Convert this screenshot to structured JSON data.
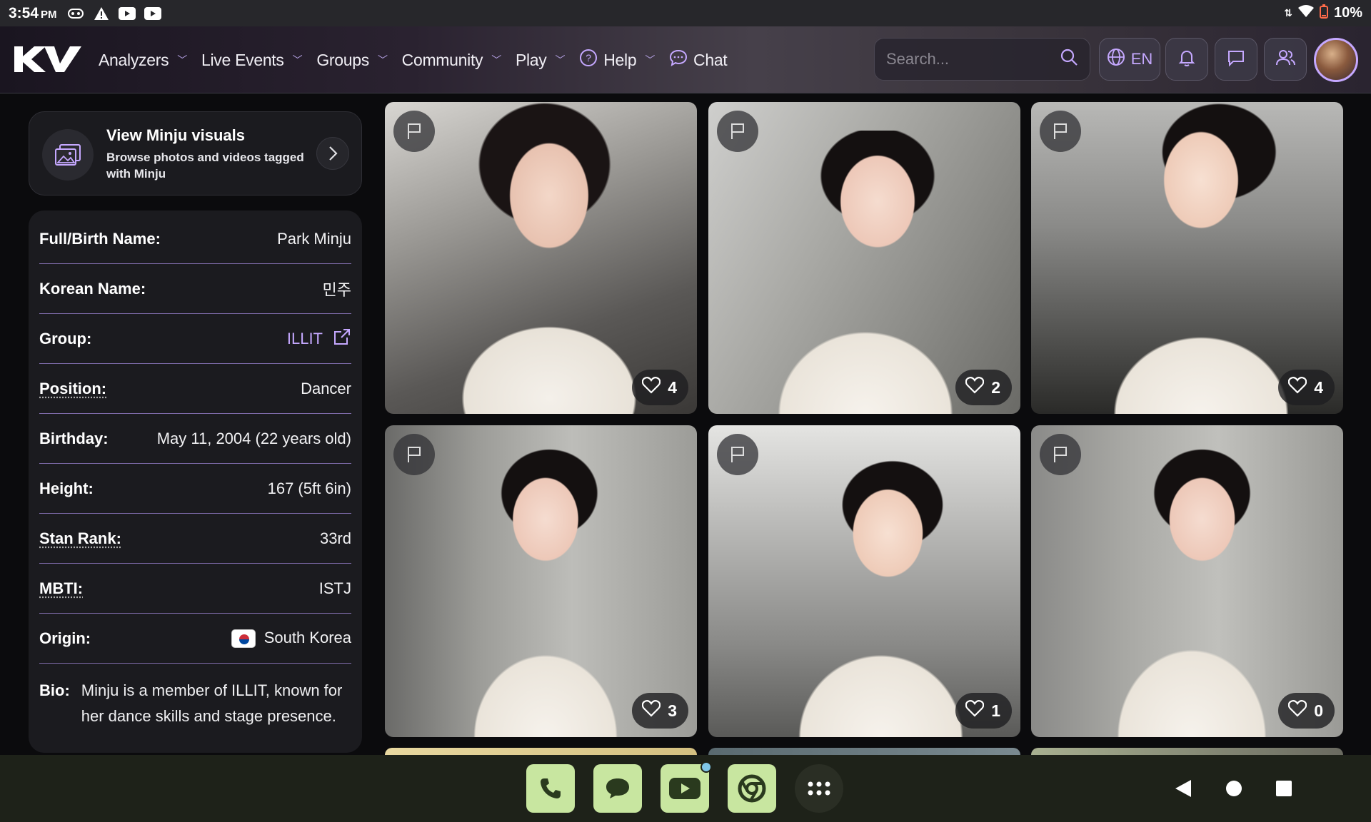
{
  "status_bar": {
    "time": "3:54",
    "ampm": "PM",
    "battery": "10%"
  },
  "nav": {
    "items": [
      {
        "label": "Analyzers",
        "has_chevron": true
      },
      {
        "label": "Live Events",
        "has_chevron": true
      },
      {
        "label": "Groups",
        "has_chevron": true
      },
      {
        "label": "Community",
        "has_chevron": true
      },
      {
        "label": "Play",
        "has_chevron": true
      },
      {
        "label": "Help",
        "has_chevron": true,
        "icon": "help-circle-icon"
      },
      {
        "label": "Chat",
        "has_chevron": false,
        "icon": "chat-bubble-icon"
      }
    ],
    "search_placeholder": "Search...",
    "language": "EN"
  },
  "visuals": {
    "title": "View Minju visuals",
    "description": "Browse photos and videos tagged with Minju"
  },
  "profile": {
    "rows": [
      {
        "label": "Full/Birth Name:",
        "value": "Park Minju"
      },
      {
        "label": "Korean Name:",
        "value": "민주"
      },
      {
        "label": "Group:",
        "value": "ILLIT"
      },
      {
        "label": "Position:",
        "value": "Dancer"
      },
      {
        "label": "Birthday:",
        "value": "May 11, 2004 (22 years old)"
      },
      {
        "label": "Height:",
        "value": "167 (5ft 6in)"
      },
      {
        "label": "Stan Rank:",
        "value": "33rd"
      },
      {
        "label": "MBTI:",
        "value": "ISTJ"
      },
      {
        "label": "Origin:",
        "value": "South Korea"
      }
    ],
    "bio_label": "Bio:",
    "bio_text": "Minju is a member of ILLIT, known for her dance skills and stage presence."
  },
  "photos": [
    {
      "likes": "4"
    },
    {
      "likes": "2"
    },
    {
      "likes": "4"
    },
    {
      "likes": "3"
    },
    {
      "likes": "1"
    },
    {
      "likes": "0"
    }
  ],
  "colors": {
    "accent": "#c5a8ff",
    "divider": "#7d6aa8",
    "dock_app": "#c8e6a0"
  }
}
